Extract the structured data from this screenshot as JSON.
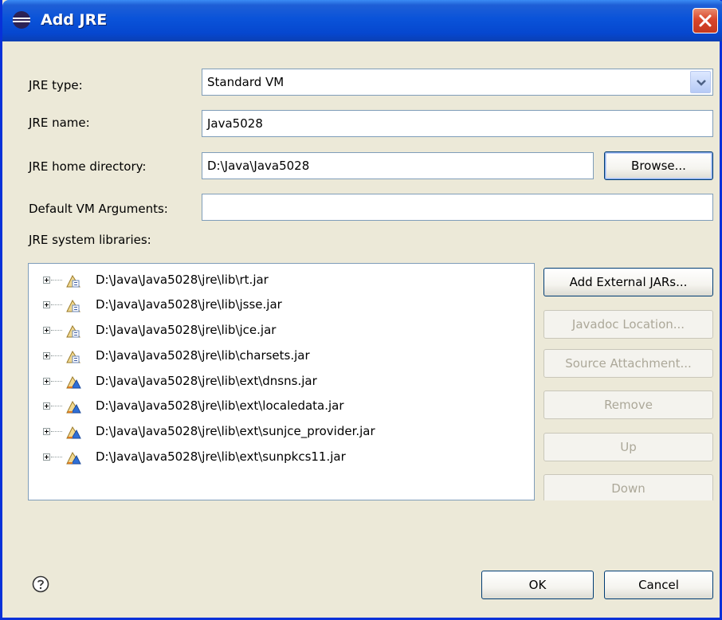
{
  "window": {
    "title": "Add JRE"
  },
  "fields": {
    "jre_type": {
      "label": "JRE type:",
      "value": "Standard VM"
    },
    "jre_name": {
      "label": "JRE name:",
      "value": "Java5028"
    },
    "jre_home": {
      "label": "JRE home directory:",
      "value": "D:\\Java\\Java5028"
    },
    "vm_args": {
      "label": "Default VM Arguments:",
      "value": ""
    }
  },
  "buttons": {
    "browse": "Browse...",
    "add_external_jars": "Add External JARs...",
    "javadoc_location": "Javadoc Location...",
    "source_attachment": "Source Attachment...",
    "remove": "Remove",
    "up": "Up",
    "down": "Down",
    "ok": "OK",
    "cancel": "Cancel"
  },
  "libraries": {
    "label": "JRE system libraries:",
    "items": [
      {
        "path": "D:\\Java\\Java5028\\jre\\lib\\rt.jar",
        "icon": "jar-icon"
      },
      {
        "path": "D:\\Java\\Java5028\\jre\\lib\\jsse.jar",
        "icon": "jar-icon"
      },
      {
        "path": "D:\\Java\\Java5028\\jre\\lib\\jce.jar",
        "icon": "jar-icon"
      },
      {
        "path": "D:\\Java\\Java5028\\jre\\lib\\charsets.jar",
        "icon": "jar-icon"
      },
      {
        "path": "D:\\Java\\Java5028\\jre\\lib\\ext\\dnsns.jar",
        "icon": "ext-jar-icon"
      },
      {
        "path": "D:\\Java\\Java5028\\jre\\lib\\ext\\localedata.jar",
        "icon": "ext-jar-icon"
      },
      {
        "path": "D:\\Java\\Java5028\\jre\\lib\\ext\\sunjce_provider.jar",
        "icon": "ext-jar-icon"
      },
      {
        "path": "D:\\Java\\Java5028\\jre\\lib\\ext\\sunpkcs11.jar",
        "icon": "ext-jar-icon"
      }
    ]
  },
  "colors": {
    "title_bar": "#0a53d9",
    "dialog_bg": "#ece9d8",
    "close_button": "#d9462b"
  }
}
